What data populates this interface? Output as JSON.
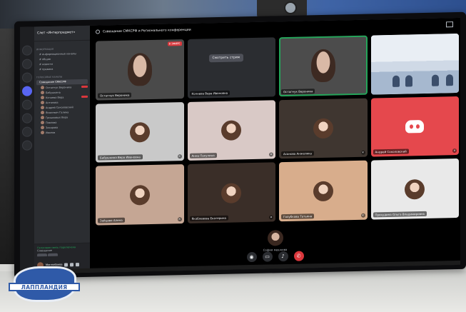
{
  "server": {
    "name": "Слет «Интерпредмет»",
    "channels": [
      {
        "label": "# информационные каналы",
        "selected": false
      },
      {
        "label": "# общие",
        "selected": false
      },
      {
        "label": "# новости",
        "selected": false
      },
      {
        "label": "# правила",
        "selected": false
      }
    ],
    "voice_channel": "Совещание СМКСРФ",
    "members": [
      "Остапчук Вероника",
      "Бабушкина",
      "Кочнева Вера",
      "Антонова",
      "Андрей Соколовский",
      "Ясюкевич Галина",
      "Гришковых Вера",
      "Павлова",
      "Захарова",
      "Иванов"
    ]
  },
  "voice_status": {
    "text": "Голосовая связь подключена",
    "sub": "Совещание"
  },
  "user_panel": {
    "name": "Миннибаева"
  },
  "call": {
    "title": "Совещание СМКСРФ и Регионального конференции",
    "screenshare_label": "Смотреть стрим",
    "tiles": [
      {
        "name": "Остапчук Вероника",
        "kind": "video-face",
        "bg": "#4a4a4a",
        "live": "В ЭФИРЕ"
      },
      {
        "name": "Кочнева Вера Ивановна",
        "kind": "screenshare",
        "bg": "#2b2d31"
      },
      {
        "name": "Остапчук Вероника",
        "kind": "video-face",
        "bg": "#4c4c4c",
        "speaking": true
      },
      {
        "name": "",
        "kind": "classroom",
        "bg": "#e9eef4"
      },
      {
        "name": "Бабушкина Вера Ивановна",
        "kind": "avatar",
        "bg": "#c9c9c9"
      },
      {
        "name": "Анна Пакулина",
        "kind": "avatar",
        "bg": "#d9c9c6"
      },
      {
        "name": "Асанова Анжелика",
        "kind": "avatar",
        "bg": "#3f3630"
      },
      {
        "name": "Андрей Соколовский",
        "kind": "discord",
        "bg": "#e5484d"
      },
      {
        "name": "Зайцева Алена",
        "kind": "avatar",
        "bg": "#c5a694"
      },
      {
        "name": "Якоблевова Екатерина",
        "kind": "avatar",
        "bg": "#3a2e28"
      },
      {
        "name": "Голубкова Татьяна",
        "kind": "avatar",
        "bg": "#d8ad8c"
      },
      {
        "name": "Прокудина Ольга Владимировна",
        "kind": "avatar",
        "bg": "#e9e9e9"
      }
    ],
    "bottom_speaker": "София мешкова"
  },
  "logo": {
    "text": "ЛАППЛАНДИЯ"
  },
  "colors": {
    "accent": "#5865f2",
    "danger": "#da373c",
    "online": "#23a559"
  }
}
